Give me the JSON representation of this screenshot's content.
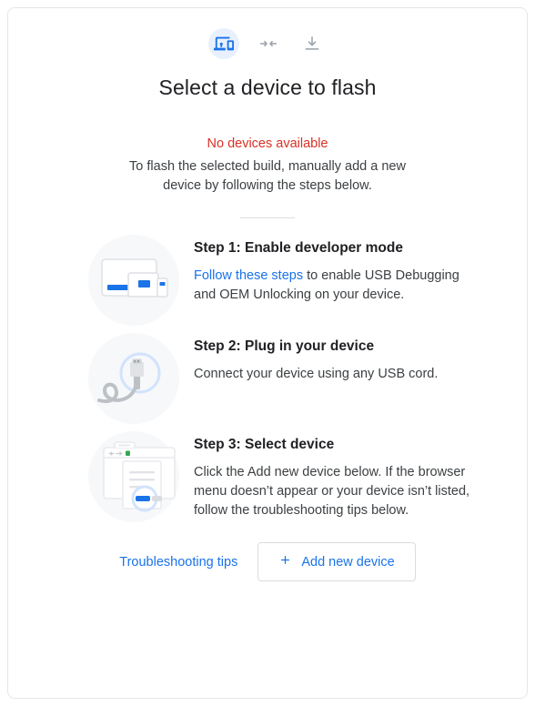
{
  "header": {
    "icons": [
      {
        "name": "devices-icon",
        "active": true
      },
      {
        "name": "connect-arrows-icon",
        "active": false
      },
      {
        "name": "download-icon",
        "active": false
      }
    ],
    "title": "Select a device to flash"
  },
  "status": {
    "error": "No devices available",
    "description": "To flash the selected build, manually add a new device by following the steps below."
  },
  "steps": [
    {
      "art": "devices-illustration",
      "title": "Step 1: Enable developer mode",
      "link_text": "Follow these steps",
      "desc_after_link": " to enable USB Debugging and OEM Unlocking on your device.",
      "desc": ""
    },
    {
      "art": "usb-cable-illustration",
      "title": "Step 2: Plug in your device",
      "link_text": "",
      "desc_after_link": "",
      "desc": "Connect your device using any USB cord."
    },
    {
      "art": "browser-dialog-illustration",
      "title": "Step 3: Select device",
      "link_text": "",
      "desc_after_link": "",
      "desc": "Click the Add new device below. If the browser menu doesn’t appear or your device isn’t listed, follow the troubleshooting tips below."
    }
  ],
  "footer": {
    "troubleshooting_label": "Troubleshooting tips",
    "add_device_label": "Add new device",
    "add_device_icon": "plus-icon"
  },
  "colors": {
    "accent_blue": "#1a73e8",
    "error_red": "#d93025",
    "icon_gray": "#9aa0a6",
    "art_bg": "#f6f8fa",
    "icon_circle_bg": "#e8f0fe",
    "border": "#dadce0",
    "text_primary": "#202124",
    "text_secondary": "#3c4043"
  }
}
